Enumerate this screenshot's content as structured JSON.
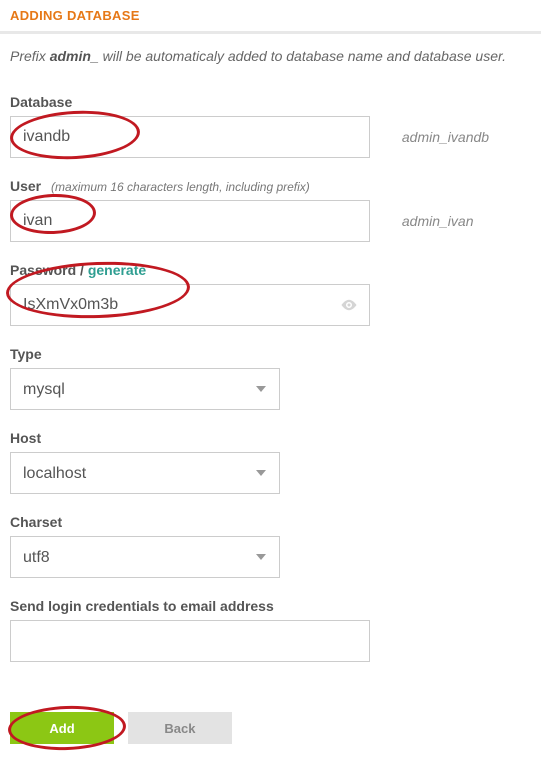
{
  "header": {
    "title": "ADDING DATABASE"
  },
  "prefix_line": {
    "pre": "Prefix ",
    "bold": "admin_",
    "post": " will be automaticaly added to database name and database user."
  },
  "db": {
    "label": "Database",
    "value": "ivandb",
    "prefixed": "admin_ivandb"
  },
  "user": {
    "label": "User",
    "hint": "(maximum 16 characters length, including prefix)",
    "value": "ivan",
    "prefixed": "admin_ivan"
  },
  "pwd": {
    "label_pre": "Password / ",
    "gen": "generate",
    "value": "IsXmVx0m3b"
  },
  "type": {
    "label": "Type",
    "value": "mysql"
  },
  "host": {
    "label": "Host",
    "value": "localhost"
  },
  "charset": {
    "label": "Charset",
    "value": "utf8"
  },
  "email": {
    "label": "Send login credentials to email address",
    "value": ""
  },
  "buttons": {
    "add": "Add",
    "back": "Back"
  }
}
